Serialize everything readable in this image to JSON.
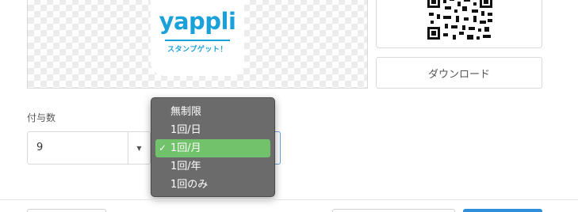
{
  "stamp": {
    "logo_text": "yappli",
    "subtitle": "スタンプゲット！"
  },
  "download_label": "ダウンロード",
  "grant_count": {
    "label": "付与数",
    "value": "9"
  },
  "frequency_dropdown": {
    "options": [
      "無制限",
      "1回/日",
      "1回/月",
      "1回/年",
      "1回のみ"
    ],
    "selected_index": 2,
    "check_mark": "✓"
  },
  "colors": {
    "brand": "#1aa1d9",
    "dropdown_bg": "#6a6b6a",
    "selected_bg": "#71c26a",
    "primary_button": "#2f8fdb"
  }
}
